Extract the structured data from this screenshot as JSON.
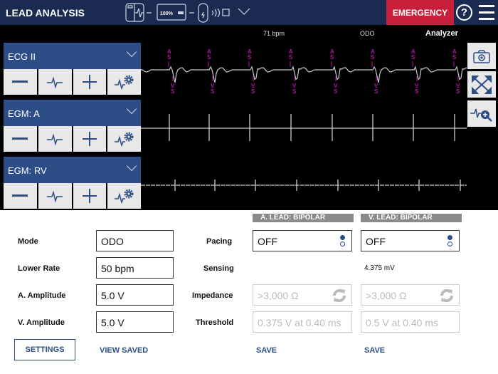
{
  "header": {
    "title": "LEAD ANALYSIS",
    "battery": "100%",
    "emergency": "EMERGENCY",
    "help": "?"
  },
  "status": {
    "rate": "71 bpm",
    "mode": "ODO",
    "source": "Analyzer"
  },
  "channels": [
    {
      "label": "ECG II"
    },
    {
      "label": "EGM: A"
    },
    {
      "label": "EGM: RV"
    }
  ],
  "markers": {
    "atrial": "AS",
    "ventricular": "VS",
    "color": "#b0169f"
  },
  "params": {
    "mode": {
      "label": "Mode",
      "value": "ODO"
    },
    "lower_rate": {
      "label": "Lower Rate",
      "value": "50 bpm"
    },
    "a_amp": {
      "label": "A. Amplitude",
      "value": "5.0 V"
    },
    "v_amp": {
      "label": "V. Amplitude",
      "value": "5.0 V"
    }
  },
  "rows": {
    "pacing": "Pacing",
    "sensing": "Sensing",
    "impedance": "Impedance",
    "threshold": "Threshold"
  },
  "a_lead": {
    "header": "A. LEAD: BIPOLAR",
    "pacing": "OFF",
    "sensing": "",
    "impedance": ">3,000 Ω",
    "threshold": "0.375 V at 0.40 ms",
    "save": "SAVE"
  },
  "v_lead": {
    "header": "V. LEAD: BIPOLAR",
    "pacing": "OFF",
    "sensing": "4.375 mV",
    "impedance": ">3,000 Ω",
    "threshold": "0.5 V at 0.40 ms",
    "save": "SAVE"
  },
  "footer": {
    "settings": "SETTINGS",
    "view_saved": "VIEW SAVED"
  }
}
